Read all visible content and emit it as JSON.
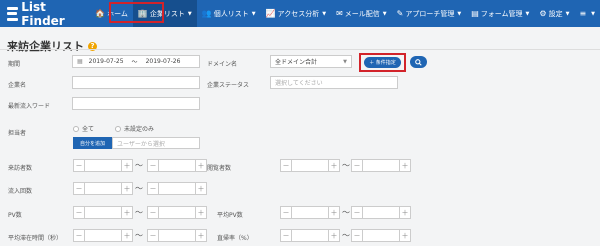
{
  "nav": {
    "brand": "List Finder",
    "items": [
      {
        "icon": "🏠",
        "icon_name": "home-icon",
        "label": "ホーム",
        "caret": false
      },
      {
        "icon": "🏢",
        "icon_name": "building-icon",
        "label": "企業リスト",
        "caret": true
      },
      {
        "icon": "👥",
        "icon_name": "users-icon",
        "label": "個人リスト",
        "caret": true
      },
      {
        "icon": "📈",
        "icon_name": "chart-icon",
        "label": "アクセス分析",
        "caret": true
      },
      {
        "icon": "✉",
        "icon_name": "mail-icon",
        "label": "メール配信",
        "caret": true
      },
      {
        "icon": "✎",
        "icon_name": "pen-icon",
        "label": "アプローチ管理",
        "caret": true
      },
      {
        "icon": "▤",
        "icon_name": "form-icon",
        "label": "フォーム管理",
        "caret": true
      },
      {
        "icon": "⚙",
        "icon_name": "gear-icon",
        "label": "設定",
        "caret": true
      },
      {
        "icon": "≡",
        "icon_name": "menu-icon",
        "label": "",
        "caret": true
      }
    ]
  },
  "page": {
    "title": "来訪企業リスト",
    "help_icon": "?"
  },
  "filters": {
    "period_label": "期間",
    "date_from": "2019-07-25",
    "date_sep": "～",
    "date_to": "2019-07-26",
    "domain_label": "ドメイン名",
    "domain_value": "全ドメイン合計",
    "condition_button": "＋ 条件指定",
    "company_name_label": "企業名",
    "company_status_label": "企業ステータス",
    "company_status_placeholder": "選択してください",
    "keyword_label": "最新流入ワード",
    "owner_label": "担当者",
    "owner_all": "全て",
    "owner_unset": "未設定のみ",
    "self_button": "自分を追加",
    "owner_placeholder": "ユーザーから選択",
    "visits_label": "来訪者数",
    "access_label": "閲覧者数",
    "inflow_label": "流入回数",
    "pv_label": "PV数",
    "avg_pv_label": "平均PV数",
    "avg_stay_label": "平均滞在時間（秒）",
    "bounce_label": "直帰率（%）",
    "minus": "－",
    "plus": "＋",
    "tilde": "～"
  },
  "colors": {
    "nav_bg": "#1f65b3",
    "highlight": "#d2232a",
    "help": "#f0a400"
  }
}
